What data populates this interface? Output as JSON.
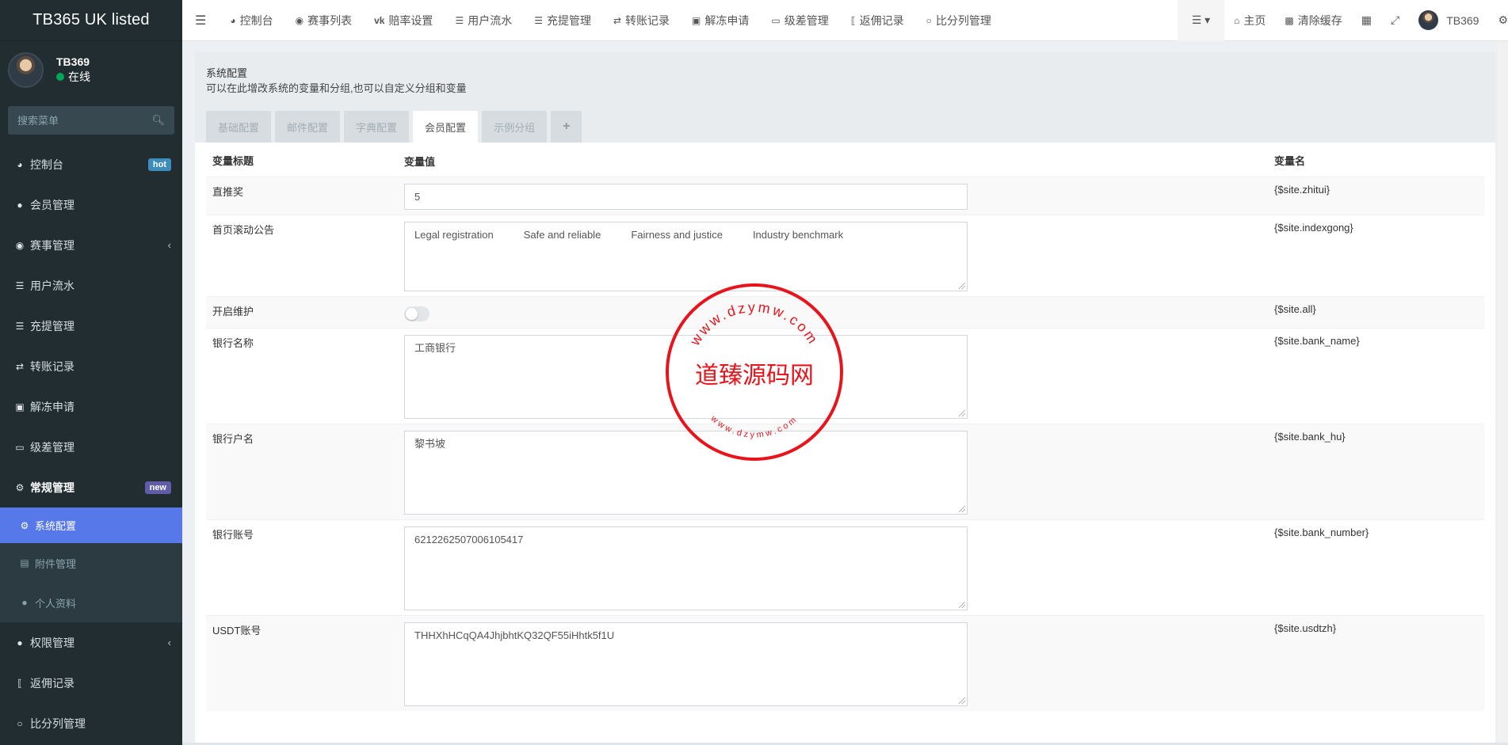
{
  "brand": {
    "title": "TB365 UK listed"
  },
  "user": {
    "name": "TB369",
    "status": "在线"
  },
  "sidebar": {
    "search_placeholder": "搜索菜单",
    "items": [
      {
        "label": "控制台",
        "icon": "dashboard-icon",
        "badge": "hot"
      },
      {
        "label": "会员管理",
        "icon": "users-icon"
      },
      {
        "label": "赛事管理",
        "icon": "globe-icon",
        "caret": "‹"
      },
      {
        "label": "用户流水",
        "icon": "list-icon"
      },
      {
        "label": "充提管理",
        "icon": "indent-list-icon"
      },
      {
        "label": "转账记录",
        "icon": "transfer-icon"
      },
      {
        "label": "解冻申请",
        "icon": "image-icon"
      },
      {
        "label": "级差管理",
        "icon": "window-icon"
      },
      {
        "label": "常规管理",
        "icon": "cogs-icon",
        "badge": "new"
      }
    ],
    "sub_items": [
      {
        "label": "系统配置",
        "icon": "gear-icon"
      },
      {
        "label": "附件管理",
        "icon": "file-image-icon"
      },
      {
        "label": "个人资料",
        "icon": "user-icon"
      }
    ],
    "bottom_items": [
      {
        "label": "权限管理",
        "icon": "users-icon",
        "caret": "‹"
      },
      {
        "label": "返佣记录",
        "icon": "commission-icon"
      },
      {
        "label": "比分列管理",
        "icon": "circle-icon"
      }
    ]
  },
  "topnav": {
    "items": [
      {
        "label": "控制台",
        "icon": "dashboard-icon"
      },
      {
        "label": "赛事列表",
        "icon": "globe-icon"
      },
      {
        "label": "赔率设置",
        "icon": "vk-icon"
      },
      {
        "label": "用户流水",
        "icon": "list-icon"
      },
      {
        "label": "充提管理",
        "icon": "indent-list-icon"
      },
      {
        "label": "转账记录",
        "icon": "transfer-icon"
      },
      {
        "label": "解冻申请",
        "icon": "image-icon"
      },
      {
        "label": "级差管理",
        "icon": "window-icon"
      },
      {
        "label": "返佣记录",
        "icon": "commission-icon"
      },
      {
        "label": "比分列管理",
        "icon": "circle-icon"
      }
    ],
    "home": "主页",
    "clear_cache": "清除缓存",
    "username": "TB369"
  },
  "page": {
    "title": "系统配置",
    "description": "可以在此增改系统的变量和分组,也可以自定义分组和变量",
    "tabs": [
      "基础配置",
      "邮件配置",
      "字典配置",
      "会员配置",
      "示例分组"
    ],
    "active_tab": "会员配置",
    "add_tab": "+"
  },
  "table": {
    "headers": {
      "title": "变量标题",
      "value": "变量值",
      "name": "变量名"
    },
    "rows": [
      {
        "title": "直推奖",
        "type": "input",
        "value": "5",
        "name": "{$site.zhitui}"
      },
      {
        "title": "首页滚动公告",
        "type": "notice",
        "values": [
          "Legal registration",
          "Safe and reliable",
          "Fairness and justice",
          "Industry benchmark"
        ],
        "name": "{$site.indexgong}"
      },
      {
        "title": "开启维护",
        "type": "switch",
        "enabled": false,
        "name": "{$site.all}"
      },
      {
        "title": "银行名称",
        "type": "textarea",
        "value": "工商银行",
        "name": "{$site.bank_name}"
      },
      {
        "title": "银行户名",
        "type": "textarea",
        "value": "黎书坡",
        "name": "{$site.bank_hu}"
      },
      {
        "title": "银行账号",
        "type": "textarea",
        "value": "6212262507006105417",
        "name": "{$site.bank_number}"
      },
      {
        "title": "USDT账号",
        "type": "textarea",
        "value": "THHXhHCqQA4JhjbhtKQ32QF55iHhtk5f1U",
        "name": "{$site.usdtzh}"
      }
    ]
  },
  "watermark": {
    "text": "道臻源码网",
    "ring_top": "www.dzymw.com",
    "ring_bottom": "www.dzymw.com",
    "color": "#e8141c"
  }
}
